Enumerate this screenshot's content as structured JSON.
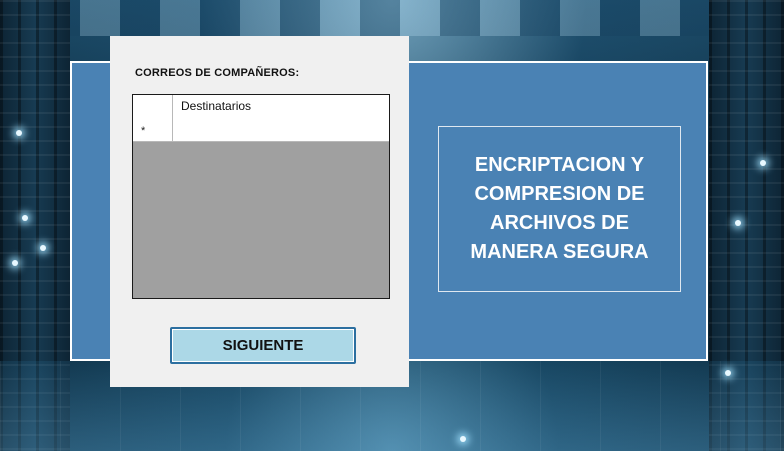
{
  "form": {
    "label": "CORREOS DE COMPAÑEROS:",
    "grid": {
      "columns": [
        "Destinatarios"
      ],
      "new_row_marker": "*",
      "new_row_value": ""
    },
    "next_button": "SIGUIENTE"
  },
  "title": {
    "lines": [
      "ENCRIPTACION Y",
      "COMPRESION DE",
      "ARCHIVOS DE",
      "MANERA SEGURA"
    ]
  },
  "colors": {
    "panel_blue": "#4a82b4",
    "button_bg": "#acd8e7",
    "grid_bg": "#a0a0a0"
  }
}
